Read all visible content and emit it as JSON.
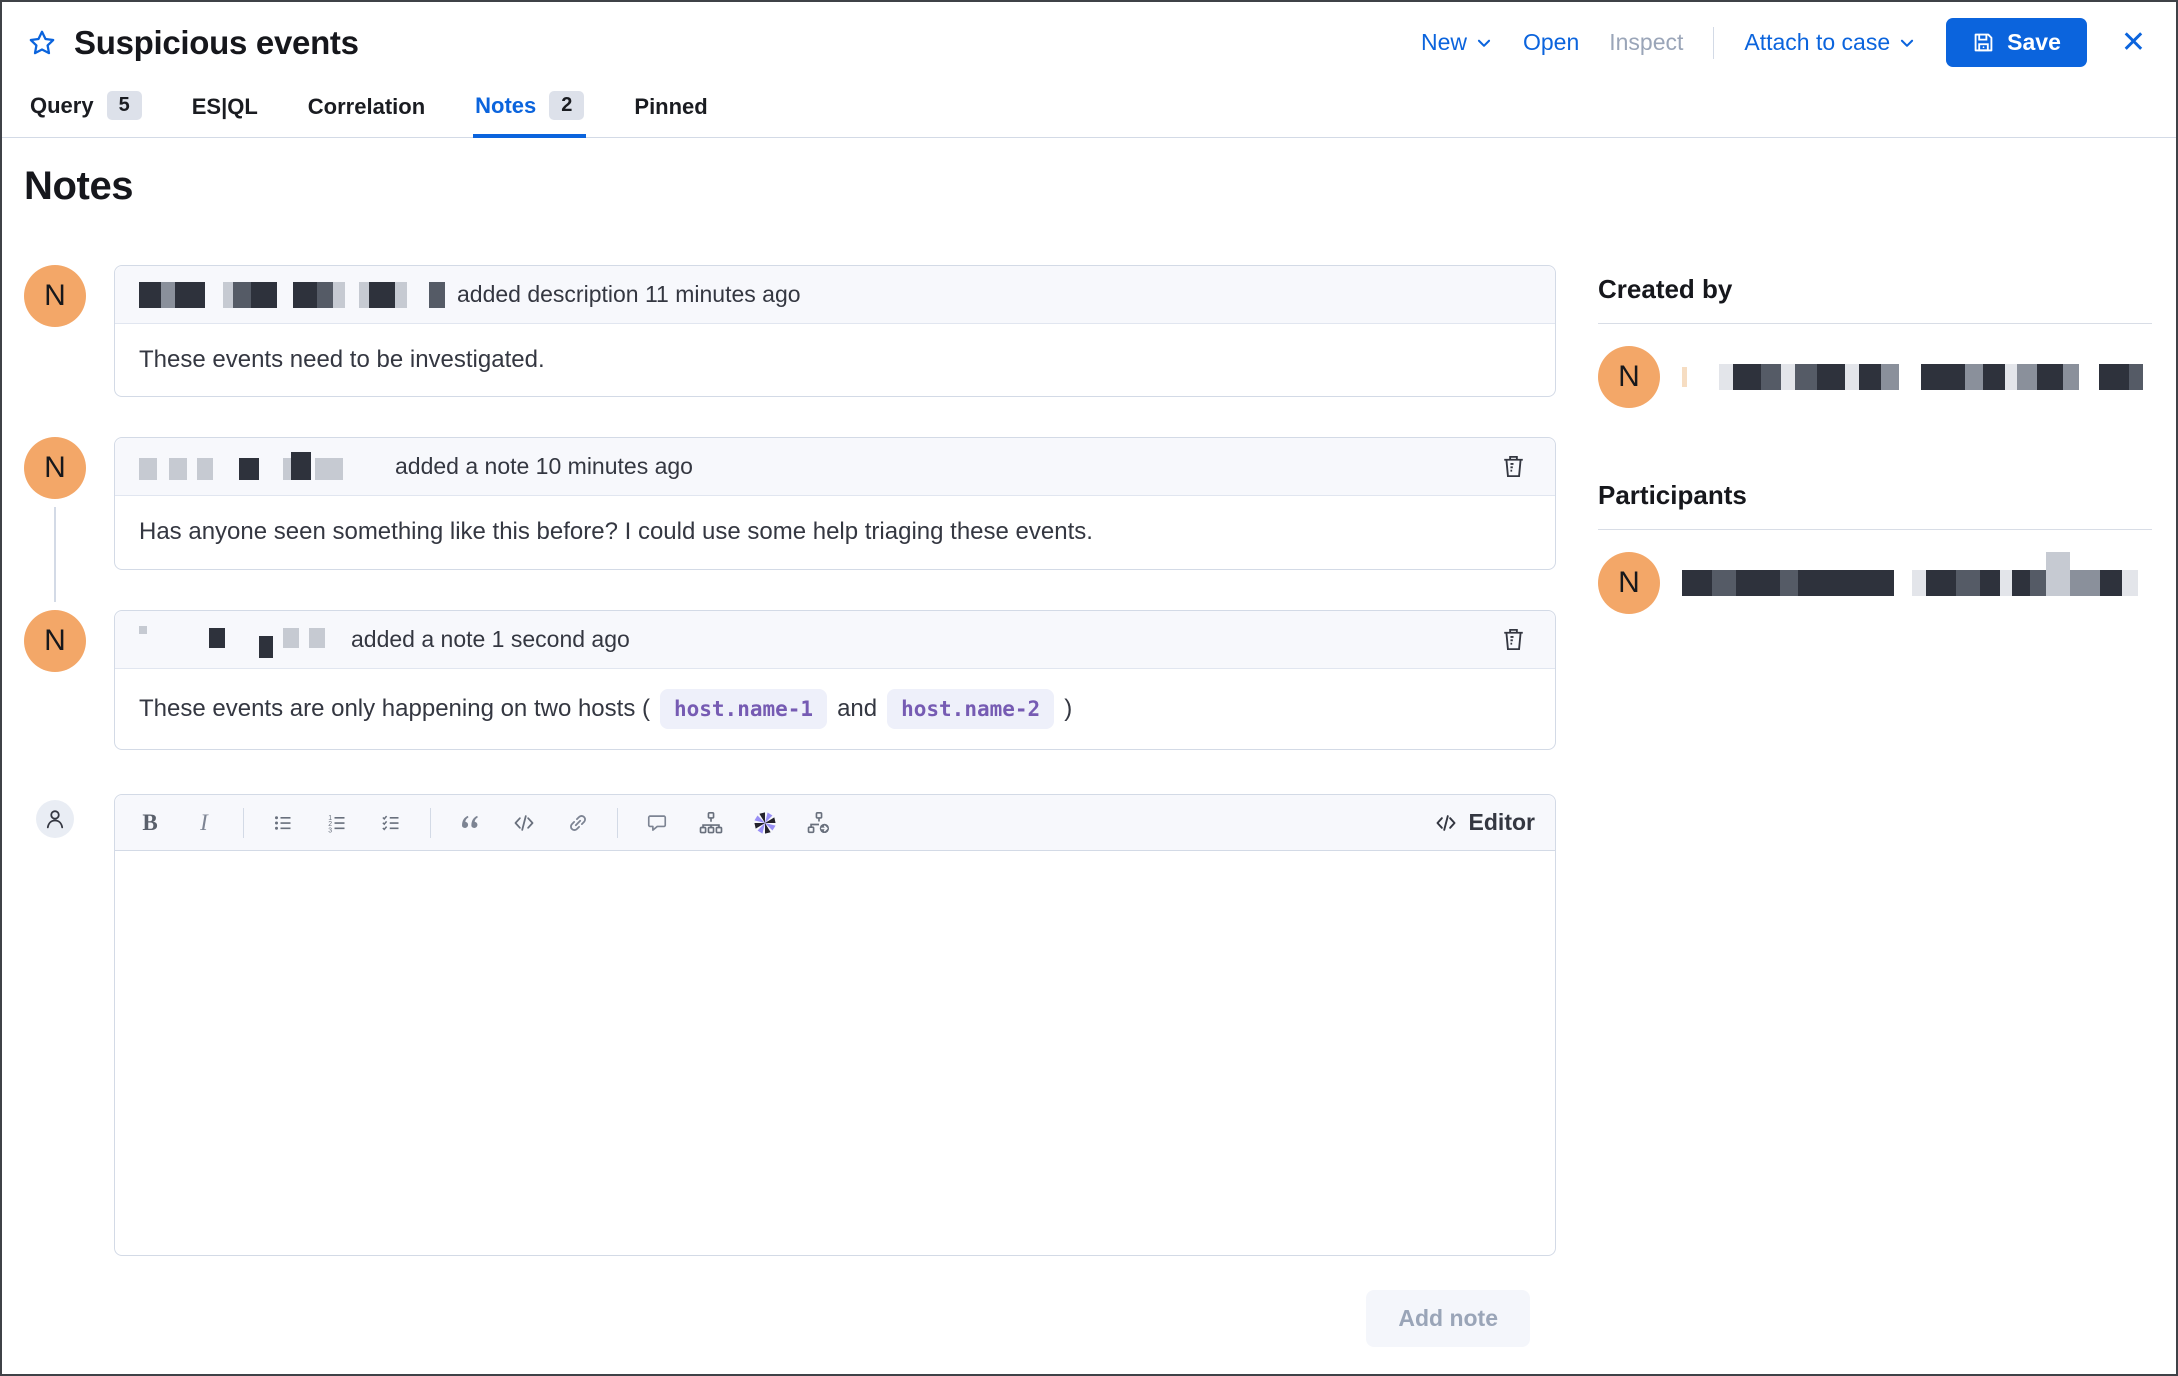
{
  "header": {
    "title": "Suspicious events",
    "actions": {
      "new": "New",
      "open": "Open",
      "inspect": "Inspect",
      "attach_to_case": "Attach to case",
      "save": "Save"
    }
  },
  "tabs": [
    {
      "label": "Query",
      "badge": "5"
    },
    {
      "label": "ES|QL"
    },
    {
      "label": "Correlation"
    },
    {
      "label": "Notes",
      "badge": "2",
      "active": true
    },
    {
      "label": "Pinned"
    }
  ],
  "notes": {
    "heading": "Notes",
    "items": [
      {
        "avatar": "N",
        "action": "added description 11 minutes ago",
        "body": "These events need to be investigated."
      },
      {
        "avatar": "N",
        "action": "added a note 10 minutes ago",
        "body": "Has anyone seen something like this before? I could use some help triaging these events."
      },
      {
        "avatar": "N",
        "action": "added a note 1 second ago",
        "body_prefix": "These events are only happening on two hosts (",
        "code1": "host.name-1",
        "body_mid": "and",
        "code2": "host.name-2",
        "body_suffix": ")"
      }
    ],
    "editor": {
      "mode_label": "Editor",
      "add_button": "Add note"
    }
  },
  "sidebar": {
    "created_by_heading": "Created by",
    "participants_heading": "Participants",
    "avatar": "N"
  },
  "icons": {
    "star": "star-outline",
    "chevron": "chevron-down",
    "save": "floppy-disk",
    "close": "cross",
    "trash": "trash-can",
    "user": "person-outline",
    "toolbar": [
      "bold",
      "italic",
      "unordered-list",
      "ordered-list",
      "task-list",
      "quote",
      "code",
      "link",
      "comment",
      "timeline-sitemap",
      "visualization-pinwheel",
      "osquery-sitemap-arrow"
    ],
    "editor_mode": "code-brackets"
  },
  "colors": {
    "primary_blue": "#0b64dd",
    "avatar_orange": "#f3a768",
    "code_purple": "#765bb3",
    "panel_border": "#d3dae6",
    "header_bg": "#f7f8fc"
  }
}
